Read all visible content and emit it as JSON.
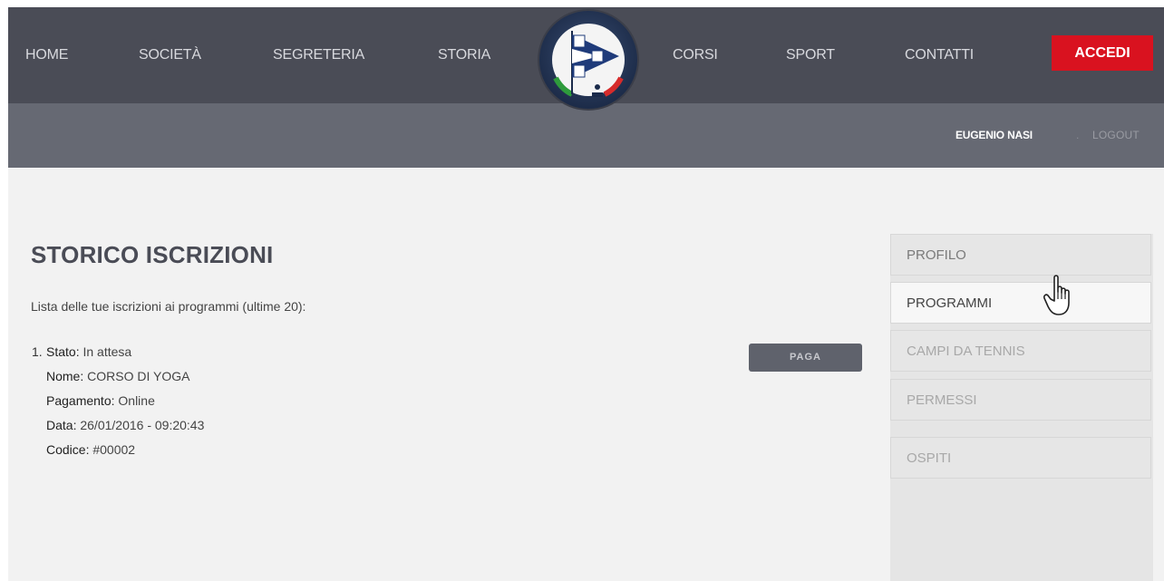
{
  "nav": {
    "items": [
      {
        "label": "HOME"
      },
      {
        "label": "SOCIETÀ"
      },
      {
        "label": "SEGRETERIA"
      },
      {
        "label": "STORIA"
      },
      {
        "label": "CORSI"
      },
      {
        "label": "SPORT"
      },
      {
        "label": "CONTATTI"
      }
    ],
    "login_label": "ACCEDI",
    "logo_icon": "club-burgee-logo-icon"
  },
  "userbar": {
    "username": "EUGENIO NASI",
    "separator": ".",
    "logout_label": "LOGOUT"
  },
  "main": {
    "title": "STORICO ISCRIZIONI",
    "intro": "Lista delle tue iscrizioni ai programmi (ultime 20):",
    "entries": [
      {
        "number": "1.",
        "stato_label": "Stato:",
        "stato_value": "In attesa",
        "nome_label": "Nome:",
        "nome_value": "CORSO DI YOGA",
        "pagamento_label": "Pagamento:",
        "pagamento_value": "Online",
        "data_label": "Data:",
        "data_value": "26/01/2016 - 09:20:43",
        "codice_label": "Codice:",
        "codice_value": "#00002",
        "pay_label": "PAGA"
      }
    ]
  },
  "sidebar": {
    "items": [
      {
        "label": "PROFILO"
      },
      {
        "label": "PROGRAMMI"
      },
      {
        "label": "CAMPI DA TENNIS"
      },
      {
        "label": "PERMESSI"
      },
      {
        "label": "OSPITI"
      }
    ]
  },
  "colors": {
    "nav_bg": "#4a4c56",
    "userbar_bg": "#666973",
    "accent_red": "#d9121f",
    "content_bg": "#f2f2f2"
  }
}
